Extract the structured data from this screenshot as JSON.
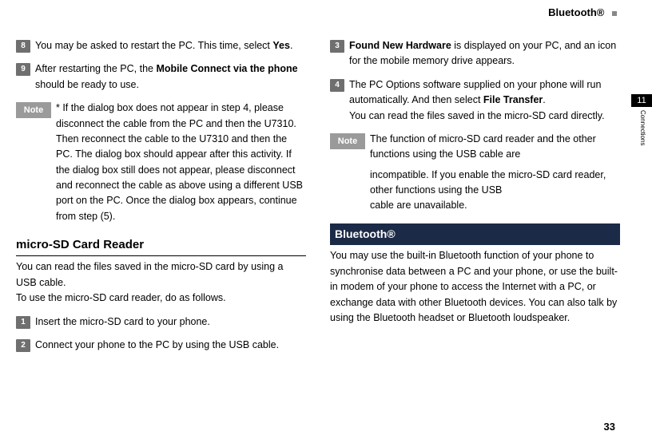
{
  "header": {
    "title": "Bluetooth®"
  },
  "sidetab": {
    "number": "11",
    "label": "Connections"
  },
  "page_number": "33",
  "left": {
    "step8": {
      "num": "8",
      "text_a": "You may be asked to restart the PC. This time, select ",
      "bold": "Yes",
      "text_b": "."
    },
    "step9": {
      "num": "9",
      "text_a": "After restarting the PC, the  ",
      "bold": "Mobile Connect via the phone",
      "text_b": " should be ready to use."
    },
    "note1": {
      "label": "Note",
      "text": "* If the dialog box does not appear in step 4, please disconnect the cable from the PC and then the U7310. Then reconnect the cable to the U7310 and then the PC. The dialog box should appear after this activity. If the dialog box still does not appear, please disconnect and reconnect the cable as above using a different USB port on the PC. Once the dialog box appears, continue from step (5)."
    },
    "subheading": "micro-SD Card Reader",
    "intro": "You can read the files saved in the micro-SD card by using a USB cable.\nTo use the micro-SD card reader, do as follows.",
    "step1": {
      "num": "1",
      "text": "Insert the micro-SD card to your phone."
    },
    "step2": {
      "num": "2",
      "text": "Connect your phone to the PC by using the USB cable."
    }
  },
  "right": {
    "step3": {
      "num": "3",
      "bold": "Found New Hardware",
      "text": " is displayed on your PC, and an icon for the mobile memory drive appears."
    },
    "step4": {
      "num": "4",
      "text_a": "The PC Options software supplied on your phone will run automatically. And then select ",
      "bold": "File Transfer",
      "text_b": ".",
      "text_c": "You can read the files saved in the micro-SD card directly."
    },
    "note2": {
      "label": "Note",
      "line1": "The function of micro-SD card reader and the other functions using the USB cable are",
      "line2": "incompatible. If you enable the micro-SD card reader, other functions using the USB",
      "line3": "cable are unavailable."
    },
    "section_title": "Bluetooth®",
    "section_body": "You may use the built-in Bluetooth function of your phone to synchronise data between a PC and your phone, or use the built-in modem of your phone to access the Internet with a PC, or exchange data with other Bluetooth devices. You can also talk by using the Bluetooth headset or Bluetooth loudspeaker."
  }
}
